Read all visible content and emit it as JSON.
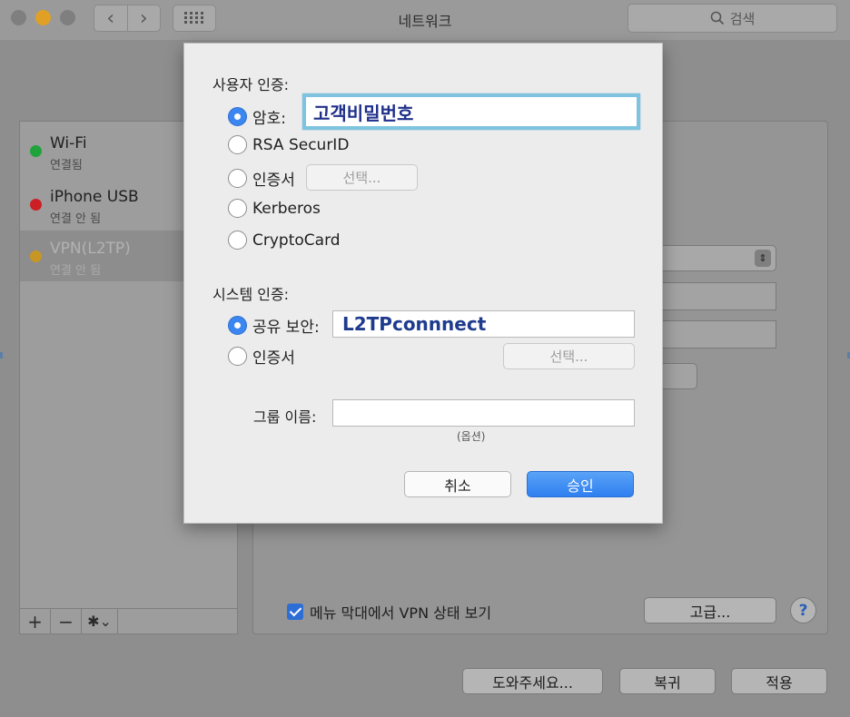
{
  "window": {
    "title": "네트워크"
  },
  "toolbar": {
    "back_glyph": "‹",
    "forward_glyph": "›",
    "search_placeholder": "검색"
  },
  "services": [
    {
      "name": "Wi-Fi",
      "status": "연결됨",
      "color": "#1fa33a"
    },
    {
      "name": "iPhone USB",
      "status": "연결 안 됨",
      "color": "#cc1f25"
    },
    {
      "name": "VPN(L2TP)",
      "status": "연결 안 됨",
      "color": "#c79624",
      "selected": true
    }
  ],
  "list_tools": {
    "add": "+",
    "remove": "−",
    "gear": "✱⌄"
  },
  "main": {
    "show_vpn_status_label": "메뉴 막대에서 VPN 상태 보기",
    "show_vpn_status_checked": true,
    "advanced_label": "고급...",
    "help_label": "?"
  },
  "footer": {
    "assist_label": "도와주세요...",
    "revert_label": "복귀",
    "apply_label": "적용"
  },
  "sheet": {
    "user_auth_label": "사용자 인증:",
    "password_label": "암호:",
    "password_value": "고객비밀번호",
    "rsa_label": "RSA SecurID",
    "cert_label": "인증서",
    "select_label": "선택...",
    "kerberos_label": "Kerberos",
    "cryptocard_label": "CryptoCard",
    "system_auth_label": "시스템 인증:",
    "shared_secret_label": "공유 보안:",
    "shared_secret_value": "L2TPconnnect",
    "sys_cert_label": "인증서",
    "sys_select_label": "선택...",
    "group_name_label": "그룹 이름:",
    "group_name_value": "",
    "optional_note": "(옵션)",
    "cancel_label": "취소",
    "ok_label": "승인"
  },
  "colors": {
    "accent": "#3b86f0",
    "focus_ring": "#7ec3e0"
  }
}
